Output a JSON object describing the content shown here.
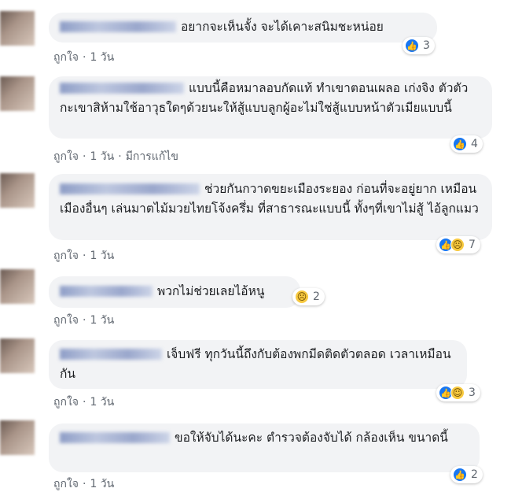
{
  "comments": [
    {
      "text": "อยากจะเห็นจั้ง จะได้เคาะสนิมชะหน่อย",
      "like": "ถูกใจ",
      "time": "1 วัน",
      "edited": "",
      "reaction_icons": [
        "like-icon"
      ],
      "reaction_count": "3"
    },
    {
      "text": "แบบนี้คือหมาลอบกัดแท้ ทำเขาตอนเผลอ เก่งจิง ตัวตัวกะเขาสิห้ามใช้อาวุธใดๆด้วยนะให้สู้แบบลูกผู้อะไม่ใช่สู้แบบหน้าตัวเมียแบบนี้",
      "like": "ถูกใจ",
      "time": "1 วัน",
      "edited": "มีการแก้ไข",
      "reaction_icons": [
        "like-icon"
      ],
      "reaction_count": "4"
    },
    {
      "text": "ช่วยกันกวาดขยะเมืองระยอง ก่อนที่จะอยู่ยาก เหมือนเมืองอื่นๆ เล่นมาตไม้มวยไทยโจ้งครึ่ม ที่สาธารณะแบบนี้ ทั้งๆที่เขาไม่สู้ ไอ้ลูกแมว",
      "like": "ถูกใจ",
      "time": "1 วัน",
      "edited": "",
      "reaction_icons": [
        "like-icon",
        "sad-icon"
      ],
      "reaction_count": "7"
    },
    {
      "text": "พวกไม่ช่วยเลยไอ้หนู",
      "like": "ถูกใจ",
      "time": "1 วัน",
      "edited": "",
      "reaction_icons": [
        "sad-icon"
      ],
      "reaction_count": "2"
    },
    {
      "text": "เจ็บฟรี ทุกวันนี้ถึงกับต้องพกมีดติดตัวตลอด เวลาเหมือนกัน",
      "like": "ถูกใจ",
      "time": "1 วัน",
      "edited": "",
      "reaction_icons": [
        "like-icon",
        "haha-icon"
      ],
      "reaction_count": "3"
    },
    {
      "text": "ขอให้จับได้นะคะ ตำรวจต้องจับได้ กล้องเห็น ขนาดนี้",
      "like": "ถูกใจ",
      "time": "1 วัน",
      "edited": "",
      "reaction_icons": [
        "like-icon"
      ],
      "reaction_count": "2"
    }
  ],
  "colors": {
    "bubble": "#f2f3f5",
    "meta_text": "#606770",
    "like_blue": "#1877f2",
    "emoji_yellow": "#f7c940"
  }
}
